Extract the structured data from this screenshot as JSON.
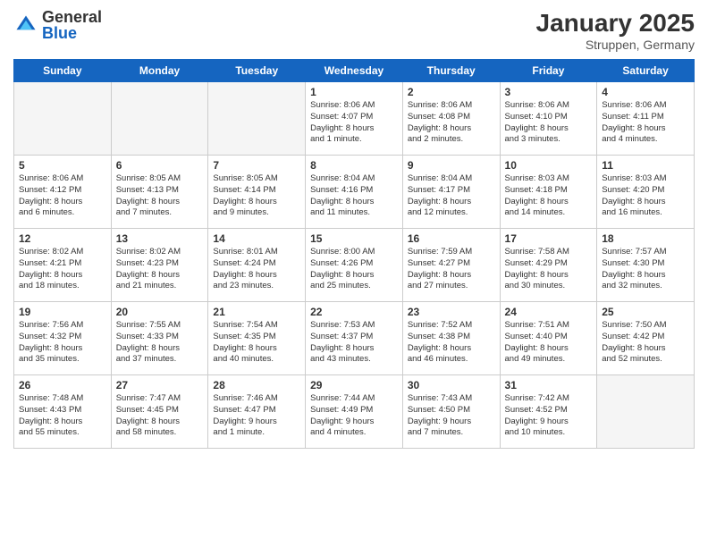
{
  "header": {
    "logo_general": "General",
    "logo_blue": "Blue",
    "month": "January 2025",
    "location": "Struppen, Germany"
  },
  "days_of_week": [
    "Sunday",
    "Monday",
    "Tuesday",
    "Wednesday",
    "Thursday",
    "Friday",
    "Saturday"
  ],
  "weeks": [
    [
      {
        "day": "",
        "info": ""
      },
      {
        "day": "",
        "info": ""
      },
      {
        "day": "",
        "info": ""
      },
      {
        "day": "1",
        "info": "Sunrise: 8:06 AM\nSunset: 4:07 PM\nDaylight: 8 hours\nand 1 minute."
      },
      {
        "day": "2",
        "info": "Sunrise: 8:06 AM\nSunset: 4:08 PM\nDaylight: 8 hours\nand 2 minutes."
      },
      {
        "day": "3",
        "info": "Sunrise: 8:06 AM\nSunset: 4:10 PM\nDaylight: 8 hours\nand 3 minutes."
      },
      {
        "day": "4",
        "info": "Sunrise: 8:06 AM\nSunset: 4:11 PM\nDaylight: 8 hours\nand 4 minutes."
      }
    ],
    [
      {
        "day": "5",
        "info": "Sunrise: 8:06 AM\nSunset: 4:12 PM\nDaylight: 8 hours\nand 6 minutes."
      },
      {
        "day": "6",
        "info": "Sunrise: 8:05 AM\nSunset: 4:13 PM\nDaylight: 8 hours\nand 7 minutes."
      },
      {
        "day": "7",
        "info": "Sunrise: 8:05 AM\nSunset: 4:14 PM\nDaylight: 8 hours\nand 9 minutes."
      },
      {
        "day": "8",
        "info": "Sunrise: 8:04 AM\nSunset: 4:16 PM\nDaylight: 8 hours\nand 11 minutes."
      },
      {
        "day": "9",
        "info": "Sunrise: 8:04 AM\nSunset: 4:17 PM\nDaylight: 8 hours\nand 12 minutes."
      },
      {
        "day": "10",
        "info": "Sunrise: 8:03 AM\nSunset: 4:18 PM\nDaylight: 8 hours\nand 14 minutes."
      },
      {
        "day": "11",
        "info": "Sunrise: 8:03 AM\nSunset: 4:20 PM\nDaylight: 8 hours\nand 16 minutes."
      }
    ],
    [
      {
        "day": "12",
        "info": "Sunrise: 8:02 AM\nSunset: 4:21 PM\nDaylight: 8 hours\nand 18 minutes."
      },
      {
        "day": "13",
        "info": "Sunrise: 8:02 AM\nSunset: 4:23 PM\nDaylight: 8 hours\nand 21 minutes."
      },
      {
        "day": "14",
        "info": "Sunrise: 8:01 AM\nSunset: 4:24 PM\nDaylight: 8 hours\nand 23 minutes."
      },
      {
        "day": "15",
        "info": "Sunrise: 8:00 AM\nSunset: 4:26 PM\nDaylight: 8 hours\nand 25 minutes."
      },
      {
        "day": "16",
        "info": "Sunrise: 7:59 AM\nSunset: 4:27 PM\nDaylight: 8 hours\nand 27 minutes."
      },
      {
        "day": "17",
        "info": "Sunrise: 7:58 AM\nSunset: 4:29 PM\nDaylight: 8 hours\nand 30 minutes."
      },
      {
        "day": "18",
        "info": "Sunrise: 7:57 AM\nSunset: 4:30 PM\nDaylight: 8 hours\nand 32 minutes."
      }
    ],
    [
      {
        "day": "19",
        "info": "Sunrise: 7:56 AM\nSunset: 4:32 PM\nDaylight: 8 hours\nand 35 minutes."
      },
      {
        "day": "20",
        "info": "Sunrise: 7:55 AM\nSunset: 4:33 PM\nDaylight: 8 hours\nand 37 minutes."
      },
      {
        "day": "21",
        "info": "Sunrise: 7:54 AM\nSunset: 4:35 PM\nDaylight: 8 hours\nand 40 minutes."
      },
      {
        "day": "22",
        "info": "Sunrise: 7:53 AM\nSunset: 4:37 PM\nDaylight: 8 hours\nand 43 minutes."
      },
      {
        "day": "23",
        "info": "Sunrise: 7:52 AM\nSunset: 4:38 PM\nDaylight: 8 hours\nand 46 minutes."
      },
      {
        "day": "24",
        "info": "Sunrise: 7:51 AM\nSunset: 4:40 PM\nDaylight: 8 hours\nand 49 minutes."
      },
      {
        "day": "25",
        "info": "Sunrise: 7:50 AM\nSunset: 4:42 PM\nDaylight: 8 hours\nand 52 minutes."
      }
    ],
    [
      {
        "day": "26",
        "info": "Sunrise: 7:48 AM\nSunset: 4:43 PM\nDaylight: 8 hours\nand 55 minutes."
      },
      {
        "day": "27",
        "info": "Sunrise: 7:47 AM\nSunset: 4:45 PM\nDaylight: 8 hours\nand 58 minutes."
      },
      {
        "day": "28",
        "info": "Sunrise: 7:46 AM\nSunset: 4:47 PM\nDaylight: 9 hours\nand 1 minute."
      },
      {
        "day": "29",
        "info": "Sunrise: 7:44 AM\nSunset: 4:49 PM\nDaylight: 9 hours\nand 4 minutes."
      },
      {
        "day": "30",
        "info": "Sunrise: 7:43 AM\nSunset: 4:50 PM\nDaylight: 9 hours\nand 7 minutes."
      },
      {
        "day": "31",
        "info": "Sunrise: 7:42 AM\nSunset: 4:52 PM\nDaylight: 9 hours\nand 10 minutes."
      },
      {
        "day": "",
        "info": ""
      }
    ]
  ]
}
